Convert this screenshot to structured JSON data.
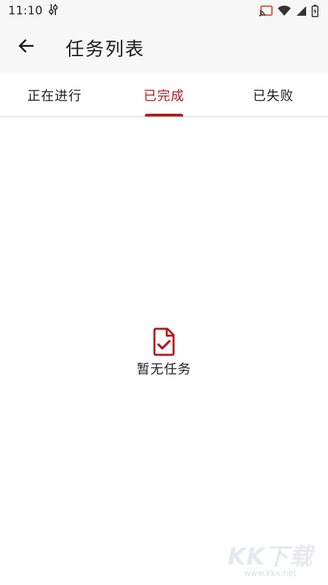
{
  "status_bar": {
    "time": "11:10",
    "icons": [
      "settings-sliders-icon",
      "cast-icon",
      "wifi-icon",
      "signal-icon",
      "battery-charging-icon"
    ]
  },
  "app_bar": {
    "back_icon": "arrow-left-icon",
    "title": "任务列表"
  },
  "tabs": [
    {
      "label": "正在进行",
      "active": false
    },
    {
      "label": "已完成",
      "active": true
    },
    {
      "label": "已失败",
      "active": false
    }
  ],
  "empty_state": {
    "icon": "document-check-icon",
    "text": "暂无任务"
  },
  "watermark": {
    "logo": "KK下载",
    "url": "www.kkx.net"
  },
  "colors": {
    "accent": "#b3191c",
    "app_bar_bg": "#f7f7f7",
    "divider": "#cfcfcf"
  }
}
